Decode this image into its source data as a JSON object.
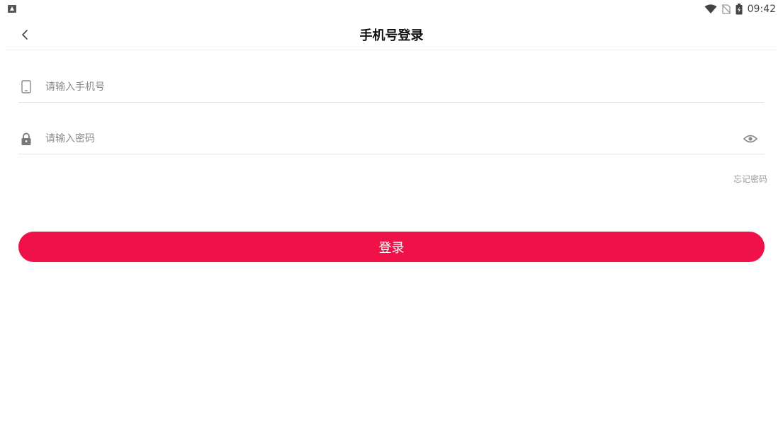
{
  "status_bar": {
    "time": "09:42",
    "icons": [
      "app-notification-icon",
      "wifi-icon",
      "no-sim-icon",
      "battery-icon"
    ]
  },
  "header": {
    "title": "手机号登录",
    "back_icon": "chevron-left-icon"
  },
  "form": {
    "phone": {
      "placeholder": "请输入手机号",
      "value": "",
      "icon": "phone-icon"
    },
    "password": {
      "placeholder": "请输入密码",
      "value": "",
      "icon": "lock-icon",
      "toggle_icon": "eye-icon"
    },
    "forgot_label": "忘记密码",
    "submit_label": "登录"
  },
  "colors": {
    "accent": "#ee1249",
    "divider": "#e3e3e3",
    "placeholder": "#8a8a8a",
    "icon": "#666666"
  }
}
